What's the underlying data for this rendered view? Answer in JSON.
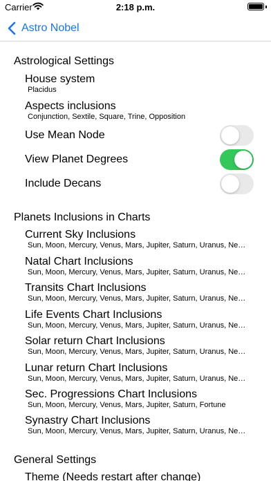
{
  "status_bar": {
    "carrier": "Carrier",
    "time": "2:18 p.m."
  },
  "nav": {
    "back_label": "Astro Nobel"
  },
  "astrological": {
    "title": "Astrological Settings",
    "house_system": {
      "label": "House system",
      "value": "Placidus"
    },
    "aspects": {
      "label": "Aspects inclusions",
      "value": "Conjunction, Sextile, Square, Trine, Opposition"
    },
    "toggles": [
      {
        "label": "Use Mean Node",
        "on": false
      },
      {
        "label": "View Planet Degrees",
        "on": true
      },
      {
        "label": "Include Decans",
        "on": false
      }
    ]
  },
  "planets": {
    "title": "Planets Inclusions in Charts",
    "items": [
      {
        "label": "Current Sky Inclusions",
        "value": "Sun, Moon, Mercury, Venus, Mars, Jupiter, Saturn, Uranus, Neptune, Pluto"
      },
      {
        "label": "Natal Chart Inclusions",
        "value": "Sun, Moon, Mercury, Venus, Mars, Jupiter, Saturn, Uranus, Neptune, Pluto"
      },
      {
        "label": "Transits Chart Inclusions",
        "value": "Sun, Moon, Mercury, Venus, Mars, Jupiter, Saturn, Uranus, Neptune, Pluto"
      },
      {
        "label": "Life Events Chart Inclusions",
        "value": "Sun, Moon, Mercury, Venus, Mars, Jupiter, Saturn, Uranus, Neptune, Pluto"
      },
      {
        "label": "Solar return Chart Inclusions",
        "value": "Sun, Moon, Mercury, Venus, Mars, Jupiter, Saturn, Uranus, Neptune, Pluto"
      },
      {
        "label": "Lunar return Chart Inclusions",
        "value": "Sun, Moon, Mercury, Venus, Mars, Jupiter, Saturn, Uranus, Neptune, Pluto"
      },
      {
        "label": "Sec. Progressions Chart Inclusions",
        "value": "Sun, Moon, Mercury, Venus, Mars, Jupiter, Saturn, Fortune"
      },
      {
        "label": "Synastry Chart Inclusions",
        "value": "Sun, Moon, Mercury, Venus, Mars, Jupiter, Saturn, Uranus, Neptune, Pluto"
      }
    ]
  },
  "general": {
    "title": "General Settings",
    "theme_label": "Theme (Needs restart after change)"
  },
  "colors": {
    "accent": "#1a73f0",
    "toggle_on": "#34c759",
    "toggle_off": "#e9e9ea"
  },
  "icons": {
    "back": "chevron-left-icon",
    "wifi": "wifi-icon",
    "battery": "battery-icon"
  }
}
